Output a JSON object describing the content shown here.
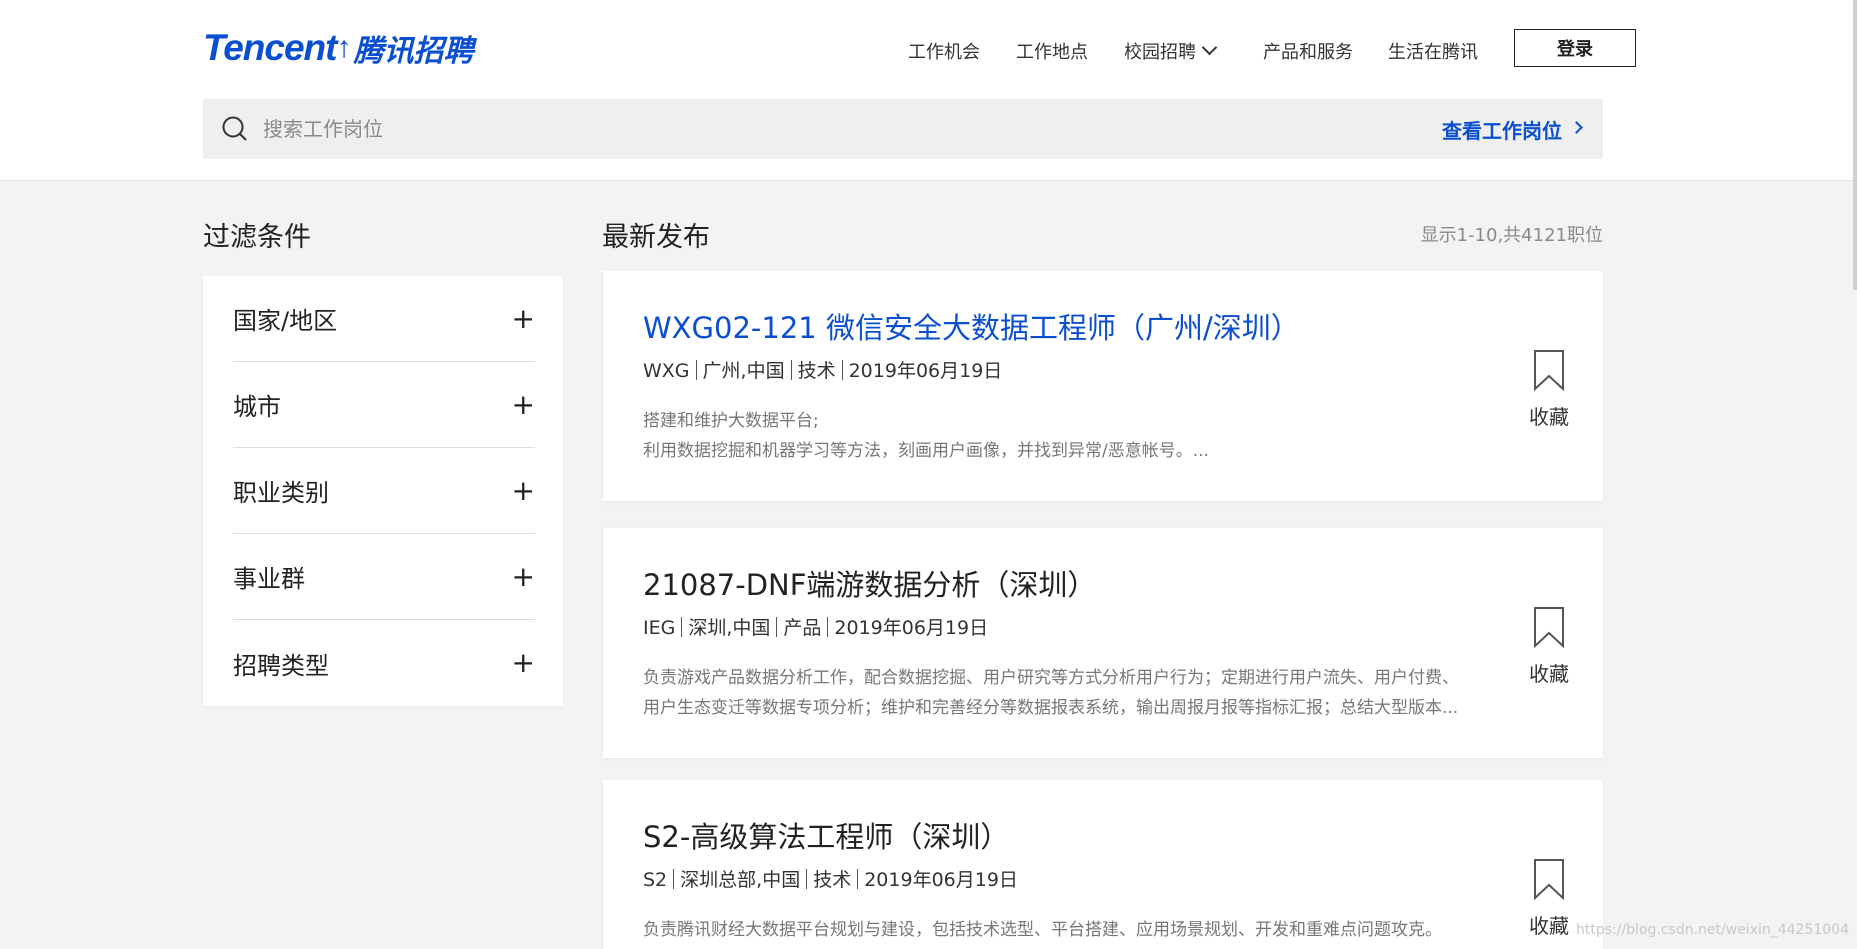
{
  "brand": {
    "logo_en": "Tencent",
    "logo_cn": "腾讯招聘",
    "color": "#0b4fd1"
  },
  "nav": {
    "items": [
      {
        "label": "工作机会"
      },
      {
        "label": "工作地点"
      },
      {
        "label": "校园招聘"
      },
      {
        "label": "产品和服务"
      },
      {
        "label": "生活在腾讯"
      }
    ],
    "login": "登录"
  },
  "search": {
    "placeholder": "搜索工作岗位",
    "link": "查看工作岗位"
  },
  "filters": {
    "title": "过滤条件",
    "items": [
      {
        "label": "国家/地区"
      },
      {
        "label": "城市"
      },
      {
        "label": "职业类别"
      },
      {
        "label": "事业群"
      },
      {
        "label": "招聘类型"
      }
    ]
  },
  "listing": {
    "title": "最新发布",
    "count": "显示1-10,共4121职位",
    "bookmark_label": "收藏",
    "jobs": [
      {
        "title": "WXG02-121 微信安全大数据工程师（广州/深圳）",
        "group": "WXG",
        "location": "广州,中国",
        "category": "技术",
        "date": "2019年06月19日",
        "desc": [
          "搭建和维护大数据平台;",
          "利用数据挖掘和机器学习等方法，刻画用户画像，并找到异常/恶意帐号。..."
        ]
      },
      {
        "title": "21087-DNF端游数据分析（深圳）",
        "group": "IEG",
        "location": "深圳,中国",
        "category": "产品",
        "date": "2019年06月19日",
        "desc": [
          "负责游戏产品数据分析工作，配合数据挖掘、用户研究等方式分析用户行为；定期进行用户流失、用户付费、",
          "用户生态变迁等数据专项分析；维护和完善经分等数据报表系统，输出周报月报等指标汇报；总结大型版本..."
        ]
      },
      {
        "title": "S2-高级算法工程师（深圳）",
        "group": "S2",
        "location": "深圳总部,中国",
        "category": "技术",
        "date": "2019年06月19日",
        "desc": [
          "负责腾讯财经大数据平台规划与建设，包括技术选型、平台搭建、应用场景规划、开发和重难点问题攻克。"
        ]
      }
    ]
  },
  "watermark": "https://blog.csdn.net/weixin_44251004"
}
